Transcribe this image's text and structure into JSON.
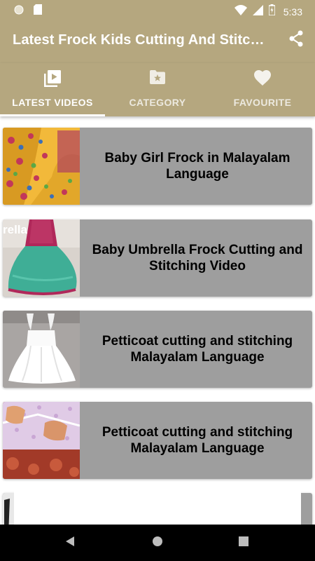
{
  "status_bar": {
    "time": "5:33",
    "icons": [
      "circle-notification-icon",
      "sd-card-icon",
      "wifi-icon",
      "signal-icon",
      "battery-charging-icon"
    ]
  },
  "app_bar": {
    "title": "Latest Frock Kids Cutting And Stitching",
    "share_icon": "share-icon"
  },
  "tabs": [
    {
      "label": "LATEST VIDEOS",
      "icon": "video-library-icon",
      "selected": true
    },
    {
      "label": "CATEGORY",
      "icon": "folder-star-icon",
      "selected": false
    },
    {
      "label": "FAVOURITE",
      "icon": "heart-icon",
      "selected": false
    }
  ],
  "videos": [
    {
      "title": "Baby Girl Frock in Malayalam Language",
      "thumbnail": "yellow-printed-frock-photo"
    },
    {
      "title": "Baby Umbrella Frock Cutting and Stitching Video",
      "thumbnail": "umbrella-frock-photo",
      "thumb_text": "rella"
    },
    {
      "title": "Petticoat cutting and stitching Malayalam Language",
      "thumbnail": "white-petticoat-photo"
    },
    {
      "title": "Petticoat cutting and stitching Malayalam Language",
      "thumbnail": "fabric-cutting-photo"
    }
  ],
  "nav_bar": {
    "back": "back-icon",
    "home": "home-icon",
    "recents": "recents-icon"
  },
  "colors": {
    "primary": "#b5a77f",
    "card": "#9e9e9e",
    "nav": "#000000"
  }
}
